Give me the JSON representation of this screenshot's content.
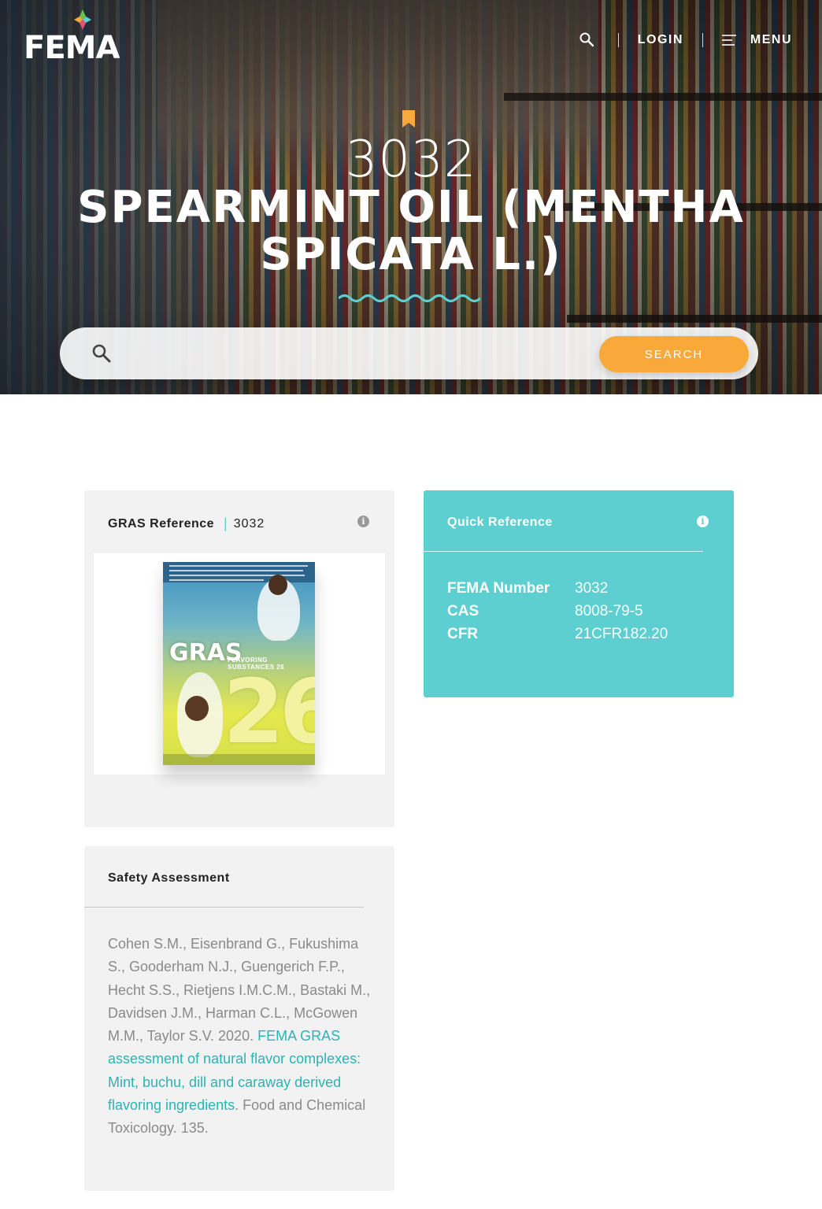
{
  "header": {
    "logo_text": "FEMA",
    "login_label": "LOGIN",
    "menu_label": "MENU"
  },
  "hero": {
    "number": "3032",
    "title": "SPEARMINT OIL (MENTHA SPICATA L.)",
    "search_placeholder": "",
    "search_button_label": "SEARCH"
  },
  "gras_card": {
    "title": "GRAS Reference",
    "number": "3032",
    "cover": {
      "brand": "GRAS",
      "subtitle": "FLAVORING SUBSTANCES 26",
      "volume": "26"
    }
  },
  "quick_reference": {
    "title": "Quick Reference",
    "rows": [
      {
        "label": "FEMA Number",
        "value": "3032"
      },
      {
        "label": "CAS",
        "value": "8008-79-5"
      },
      {
        "label": "CFR",
        "value": "21CFR182.20"
      }
    ]
  },
  "safety": {
    "title": "Safety Assessment",
    "authors": "Cohen S.M., Eisenbrand G., Fukushima S., Gooderham N.J., Guengerich F.P., Hecht S.S., Rietjens I.M.C.M., Bastaki M., Davidsen J.M., Harman C.L., McGowen M.M., Taylor S.V. 2020. ",
    "link_text": "FEMA GRAS assessment of natural flavor complexes: Mint, buchu, dill and caraway derived flavoring ingredients",
    "journal": ". Food and Chemical Toxicology. 135."
  },
  "colors": {
    "accent_teal": "#5ecfd0",
    "accent_orange": "#f8a93a",
    "link_teal": "#2bb3b5"
  },
  "icons": {
    "nav_search": "search-icon",
    "nav_menu": "hamburger-menu-icon",
    "bookmark": "bookmark-icon",
    "info": "info-icon"
  }
}
